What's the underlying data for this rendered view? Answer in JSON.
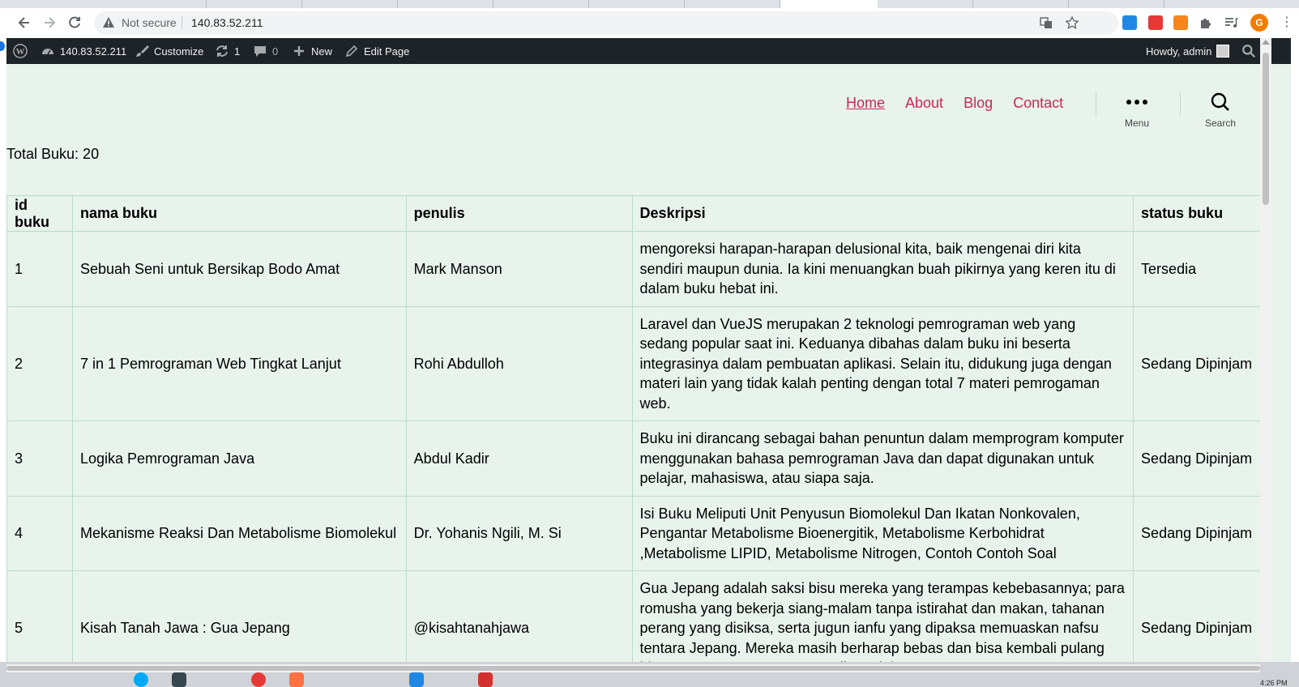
{
  "browser": {
    "security_label": "Not secure",
    "url": "140.83.52.211"
  },
  "adminbar": {
    "site_label": "140.83.52.211",
    "customize_label": "Customize",
    "updates_count": "1",
    "comments_count": "0",
    "new_label": "New",
    "edit_label": "Edit Page",
    "greeting": "Howdy, admin"
  },
  "site_nav": {
    "items": [
      {
        "label": "Home"
      },
      {
        "label": "About"
      },
      {
        "label": "Blog"
      },
      {
        "label": "Contact"
      }
    ],
    "menu_label": "Menu",
    "search_label": "Search"
  },
  "content": {
    "total_label": "Total Buku: 20"
  },
  "table": {
    "headers": [
      "id buku",
      "nama buku",
      "penulis",
      "Deskripsi",
      "status buku"
    ],
    "rows": [
      {
        "id": "1",
        "nama": "Sebuah Seni untuk Bersikap Bodo Amat",
        "penulis": "Mark Manson",
        "deskripsi": "mengoreksi harapan-harapan delusional kita, baik mengenai diri kita sendiri maupun dunia. Ia kini menuangkan buah pikirnya yang keren itu di dalam buku hebat ini.",
        "status": "Tersedia"
      },
      {
        "id": "2",
        "nama": "7 in 1 Pemrograman Web Tingkat Lanjut",
        "penulis": "Rohi Abdulloh",
        "deskripsi": "Laravel dan VueJS merupakan 2 teknologi pemrograman web yang sedang popular saat ini. Keduanya dibahas dalam buku ini beserta integrasinya dalam pembuatan aplikasi. Selain itu, didukung juga dengan materi lain yang tidak kalah penting dengan total 7 materi pemrogaman web.",
        "status": "Sedang Dipinjam"
      },
      {
        "id": "3",
        "nama": "Logika Pemrograman Java",
        "penulis": "Abdul Kadir",
        "deskripsi": "Buku ini dirancang sebagai bahan penuntun dalam memprogram komputer menggunakan bahasa pemrograman Java dan dapat digunakan untuk pelajar, mahasiswa, atau siapa saja.",
        "status": "Sedang Dipinjam"
      },
      {
        "id": "4",
        "nama": "Mekanisme Reaksi Dan Metabolisme Biomolekul",
        "penulis": "Dr. Yohanis Ngili, M. Si",
        "deskripsi": "Isi Buku Meliputi Unit Penyusun Biomolekul Dan Ikatan Nonkovalen, Pengantar Metabolisme Bioenergitik, Metabolisme Kerbohidrat ,Metabolisme LIPID, Metabolisme Nitrogen, Contoh Contoh Soal",
        "status": "Sedang Dipinjam"
      },
      {
        "id": "5",
        "nama": "Kisah Tanah Jawa : Gua Jepang",
        "penulis": "@kisahtanahjawa",
        "deskripsi": "Gua Jepang adalah saksi bisu mereka yang terampas kebebasannya; para romusha yang bekerja siang-malam tanpa istirahat dan makan, tahanan perang yang disiksa, serta jugun ianfu yang dipaksa memuaskan nafsu tentara Jepang. Mereka masih berharap bebas dan bisa kembali pulang hingga menggenggam nyawa di gua ini.",
        "status": "Sedang Dipinjam"
      }
    ]
  },
  "taskbar": {
    "clock": "4:26 PM"
  },
  "colors": {
    "page_bg": "#e8f3ec",
    "nav_link": "#cd2653",
    "adminbar_bg": "#1d2327",
    "table_border": "#b9dcc7"
  }
}
